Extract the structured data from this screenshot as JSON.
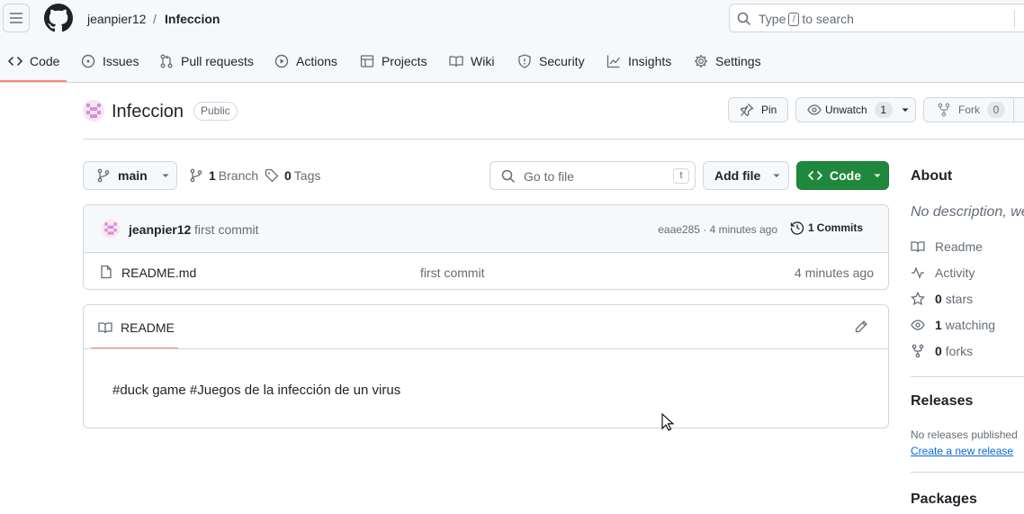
{
  "header": {
    "owner": "jeanpier12",
    "separator": "/",
    "repo": "Infeccion",
    "search": {
      "prefix": "Type",
      "key": "/",
      "suffix": "to search"
    }
  },
  "tabs": [
    {
      "label": "Code",
      "icon": "code-icon",
      "active": true
    },
    {
      "label": "Issues",
      "icon": "issue-icon"
    },
    {
      "label": "Pull requests",
      "icon": "pull-request-icon"
    },
    {
      "label": "Actions",
      "icon": "play-icon"
    },
    {
      "label": "Projects",
      "icon": "table-icon"
    },
    {
      "label": "Wiki",
      "icon": "book-icon"
    },
    {
      "label": "Security",
      "icon": "shield-icon"
    },
    {
      "label": "Insights",
      "icon": "graph-icon"
    },
    {
      "label": "Settings",
      "icon": "gear-icon"
    }
  ],
  "repo": {
    "title": "Infeccion",
    "visibility": "Public",
    "pin_label": "Pin",
    "unwatch_label": "Unwatch",
    "watch_count": "1",
    "fork_label": "Fork",
    "fork_count": "0"
  },
  "toolbar": {
    "branch": "main",
    "branch_count": "1",
    "branch_label": "Branch",
    "tag_count": "0",
    "tag_label": "Tags",
    "goto_placeholder": "Go to file",
    "goto_key": "t",
    "add_file_label": "Add file",
    "code_label": "Code"
  },
  "commit": {
    "author": "jeanpier12",
    "message": "first commit",
    "hash_time": "eaae285 · 4 minutes ago",
    "commits_count": "1",
    "commits_label": "Commits"
  },
  "files": [
    {
      "name": "README.md",
      "message": "first commit",
      "time": "4 minutes ago"
    }
  ],
  "readme": {
    "tab_label": "README",
    "content": "#duck game #Juegos de la infección de un virus"
  },
  "sidebar": {
    "about_heading": "About",
    "description": "No description, we",
    "readme_label": "Readme",
    "activity_label": "Activity",
    "stars_count": "0",
    "stars_label": "stars",
    "watching_count": "1",
    "watching_label": "watching",
    "forks_count": "0",
    "forks_label": "forks",
    "releases_heading": "Releases",
    "no_releases": "No releases published",
    "create_release": "Create a new release",
    "packages_heading": "Packages"
  },
  "colors": {
    "accent_underline": "#fd8c73",
    "green_button": "#1f883d",
    "link": "#0969da",
    "border": "#d0d7de",
    "muted": "#656d76"
  }
}
